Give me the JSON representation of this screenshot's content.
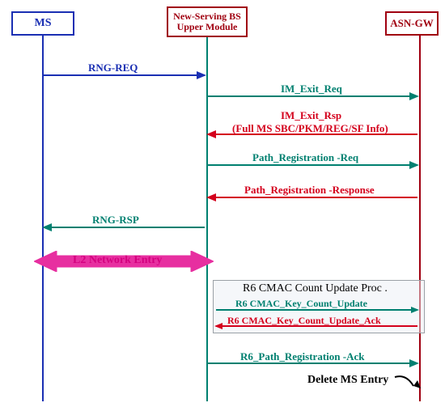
{
  "actors": {
    "ms": {
      "label": "MS",
      "color": "#1a2fb3"
    },
    "bs": {
      "label_line1": "New-Serving BS",
      "label_line2": "Upper Module",
      "color": "#008070"
    },
    "gw": {
      "label": "ASN-GW",
      "color": "#a00010"
    }
  },
  "messages": {
    "rng_req": {
      "text": "RNG-REQ",
      "color": "#1a2fb3"
    },
    "im_exit_req": {
      "text": "IM_Exit_Req",
      "color": "#008070"
    },
    "im_exit_rsp": {
      "text": "IM_Exit_Rsp",
      "sub": "(Full MS SBC/PKM/REG/SF Info)",
      "color": "#d4001c"
    },
    "path_reg_req": {
      "text": "Path_Registration -Req",
      "color": "#008070"
    },
    "path_reg_rsp": {
      "text": "Path_Registration -Response",
      "color": "#d4001c"
    },
    "rng_rsp": {
      "text": "RNG-RSP",
      "color": "#008070"
    },
    "l2_entry": {
      "text": "L2 Network Entry",
      "color": "#d4007f"
    },
    "group_title": {
      "text": "R6 CMAC Count Update Proc ."
    },
    "cmac_upd": {
      "text": "R6 CMAC_Key_Count_Update",
      "color": "#008070"
    },
    "cmac_ack": {
      "text": "R6 CMAC_Key_Count_Update_Ack",
      "color": "#d4001c"
    },
    "path_reg_ack": {
      "text": "R6_Path_Registration -Ack",
      "color": "#008070"
    },
    "delete_entry": {
      "text": "Delete MS Entry"
    }
  }
}
